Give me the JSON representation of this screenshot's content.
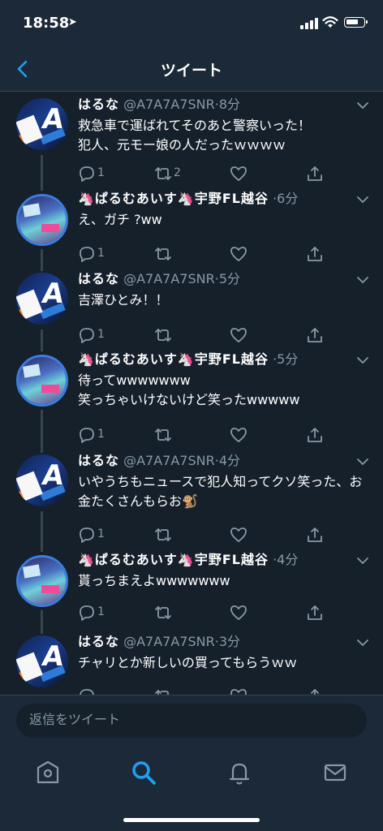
{
  "status_bar": {
    "time": "18:58"
  },
  "nav": {
    "title": "ツイート"
  },
  "tweets": [
    {
      "name": "はるな",
      "handle": "@A7A7A7SNR",
      "sep": "·",
      "time": "8分",
      "text": "救急車で運ばれてそのあと警察いった！\n犯人、元モー娘の人だったｗｗｗｗ",
      "reply_count": "1",
      "retweet_count": "2",
      "avatar": "hana"
    },
    {
      "name": "🦄ぱるむあいす🦄宇野FL越谷",
      "handle": "",
      "sep": "·",
      "time": "6分",
      "text": "え、ガチ ?ww",
      "reply_count": "1",
      "retweet_count": "",
      "avatar": "parumu"
    },
    {
      "name": "はるな",
      "handle": "@A7A7A7SNR",
      "sep": "·",
      "time": "5分",
      "text": "吉澤ひとみ！！",
      "reply_count": "1",
      "retweet_count": "",
      "avatar": "hana"
    },
    {
      "name": "🦄ぱるむあいす🦄宇野FL越谷",
      "handle": "",
      "sep": "·",
      "time": "5分",
      "text": "待ってwwwwwww\n笑っちゃいけないけど笑ったwwwww",
      "reply_count": "1",
      "retweet_count": "",
      "avatar": "parumu"
    },
    {
      "name": "はるな",
      "handle": "@A7A7A7SNR",
      "sep": "·",
      "time": "4分",
      "text": "いやうちもニュースで犯人知ってクソ笑った、お金たくさんもらお🐒",
      "reply_count": "1",
      "retweet_count": "",
      "avatar": "hana"
    },
    {
      "name": "🦄ぱるむあいす🦄宇野FL越谷",
      "handle": "",
      "sep": "·",
      "time": "4分",
      "text": "貰っちまえよwwwwwww",
      "reply_count": "1",
      "retweet_count": "",
      "avatar": "parumu"
    },
    {
      "name": "はるな",
      "handle": "@A7A7A7SNR",
      "sep": "·",
      "time": "3分",
      "text": "チャリとか新しいの買ってもらうｗｗ",
      "reply_count": "",
      "retweet_count": "",
      "avatar": "hana"
    }
  ],
  "reply": {
    "placeholder": "返信をツイート"
  },
  "tabs": [
    {
      "icon": "home-icon",
      "active": false
    },
    {
      "icon": "search-icon",
      "active": true
    },
    {
      "icon": "bell-icon",
      "active": false
    },
    {
      "icon": "mail-icon",
      "active": false
    }
  ],
  "colors": {
    "background": "#15202b",
    "bar": "#1c2938",
    "accent": "#1da1f2",
    "muted": "#8899a6"
  }
}
